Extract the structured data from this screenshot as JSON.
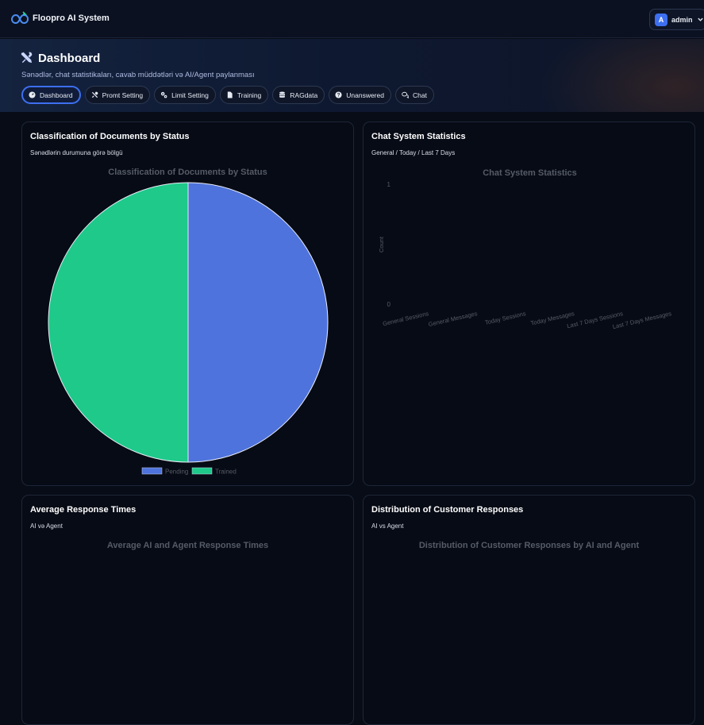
{
  "header": {
    "app_title": "Floopro AI System",
    "user": {
      "avatar_letter": "A",
      "name": "admin"
    }
  },
  "hero": {
    "title": "Dashboard",
    "subtitle": "Sənədlər, chat statistikaları, cavab müddətləri və AI/Agent paylanması"
  },
  "tabs": [
    {
      "label": "Dashboard",
      "icon": "dashboard-icon",
      "active": true
    },
    {
      "label": "Promt Setting",
      "icon": "tools-icon",
      "active": false
    },
    {
      "label": "Limit Setting",
      "icon": "gears-icon",
      "active": false
    },
    {
      "label": "Training",
      "icon": "file-icon",
      "active": false
    },
    {
      "label": "RAGdata",
      "icon": "database-icon",
      "active": false
    },
    {
      "label": "Unanswered",
      "icon": "question-icon",
      "active": false
    },
    {
      "label": "Chat",
      "icon": "chat-icon",
      "active": false
    }
  ],
  "cards": {
    "docs": {
      "title": "Classification of Documents by Status",
      "subtitle": "Sənədlərin durumuna görə bölgü"
    },
    "chat": {
      "title": "Chat System Statistics",
      "subtitle": "General / Today / Last 7 Days"
    },
    "response": {
      "title": "Average Response Times",
      "subtitle": "AI və Agent"
    },
    "distribution": {
      "title": "Distribution of Customer Responses",
      "subtitle": "AI vs Agent"
    }
  },
  "colors": {
    "accent": "#3d6ff0",
    "pending": "#4f73dc",
    "trained": "#1ec98a"
  },
  "chart_data": [
    {
      "type": "pie",
      "title": "Classification of Documents by Status",
      "labels": [
        "Pending",
        "Trained"
      ],
      "values": [
        1,
        1
      ],
      "colors": [
        "#4f73dc",
        "#1ec98a"
      ],
      "legend": "bottom"
    },
    {
      "type": "bar",
      "title": "Chat System Statistics",
      "categories": [
        "General Sessions",
        "General Messages",
        "Today Sessions",
        "Today Messages",
        "Last 7 Days Sessions",
        "Last 7 Days Messages"
      ],
      "values": [
        0,
        0,
        0,
        0,
        0,
        0
      ],
      "ylabel": "Count",
      "yticks": [
        "0",
        "1"
      ],
      "ylim": [
        0,
        1
      ]
    },
    {
      "type": "bar",
      "title": "Average AI and Agent Response Times"
    },
    {
      "type": "pie",
      "title": "Distribution of Customer Responses by AI and Agent"
    }
  ]
}
